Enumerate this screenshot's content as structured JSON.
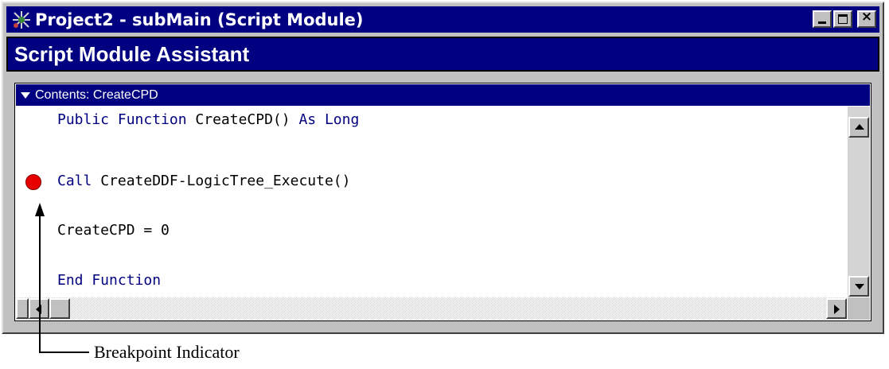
{
  "window": {
    "title": "Project2 - subMain (Script Module)",
    "icon": "project-icon",
    "controls": [
      "minimize",
      "maximize",
      "close"
    ]
  },
  "assistant": {
    "header": "Script Module Assistant"
  },
  "panel": {
    "contents_label": "Contents: CreateCPD",
    "code_lines": [
      {
        "keyword": "Public Function",
        "text": " CreateCPD()",
        "keyword2": " As Long"
      },
      {
        "keyword": "Call",
        "text": " CreateDDF-LogicTree_Execute()",
        "breakpoint": true
      },
      {
        "text": "CreateCPD = 0"
      },
      {
        "keyword": "End Function"
      }
    ]
  },
  "callout": {
    "label": "Breakpoint Indicator"
  },
  "colors": {
    "title_bar": "#000080",
    "keyword": "#000080",
    "breakpoint": "#e60000",
    "window_face": "#c0c0c0"
  }
}
